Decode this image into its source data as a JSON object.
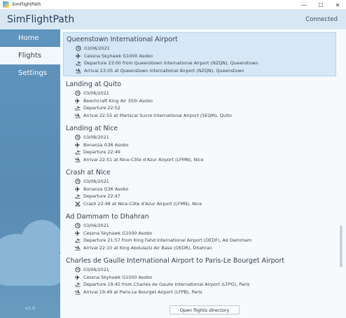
{
  "window": {
    "title": "SimFlightPath",
    "controls": {
      "minimize": "—",
      "maximize": "☐",
      "close": "✕"
    }
  },
  "header": {
    "app_name": "SimFlightPath",
    "status": "Connected"
  },
  "sidebar": {
    "items": [
      {
        "label": "Home",
        "active": false
      },
      {
        "label": "Flights",
        "active": true
      },
      {
        "label": "Settings",
        "active": false
      }
    ],
    "version": "v1.0"
  },
  "flights": [
    {
      "title": "Queenstown International Airport",
      "selected": true,
      "lines": [
        {
          "icon": "clock-icon",
          "text": "03/06/2021"
        },
        {
          "icon": "airplane-icon",
          "text": "Cessna Skyhawk G1000 Asobo"
        },
        {
          "icon": "takeoff-icon",
          "text": "Departure 23:00 from Queenstown International Airport (NZQN), Queenstown"
        },
        {
          "icon": "landing-icon",
          "text": "Arrival 23:05 at Queenstown International Airport (NZQN), Queenstown"
        }
      ]
    },
    {
      "title": "Landing at Quito",
      "selected": false,
      "lines": [
        {
          "icon": "clock-icon",
          "text": "03/06/2021"
        },
        {
          "icon": "airplane-icon",
          "text": "Beechcraft King Air 350i Asobo"
        },
        {
          "icon": "takeoff-icon",
          "text": "Departure 22:52"
        },
        {
          "icon": "landing-icon",
          "text": "Arrival 22:55 at Mariscal Sucre International Airport (SEQM), Quito"
        }
      ]
    },
    {
      "title": "Landing at Nice",
      "selected": false,
      "lines": [
        {
          "icon": "clock-icon",
          "text": "03/06/2021"
        },
        {
          "icon": "airplane-icon",
          "text": "Bonanza G36 Asobo"
        },
        {
          "icon": "takeoff-icon",
          "text": "Departure 22:49"
        },
        {
          "icon": "landing-icon",
          "text": "Arrival 22:51 at Nice-Côte d'Azur Airport (LFMN), Nice"
        }
      ]
    },
    {
      "title": "Crash at Nice",
      "selected": false,
      "lines": [
        {
          "icon": "clock-icon",
          "text": "03/06/2021"
        },
        {
          "icon": "airplane-icon",
          "text": "Bonanza G36 Asobo"
        },
        {
          "icon": "takeoff-icon",
          "text": "Departure 22:47"
        },
        {
          "icon": "crash-icon",
          "text": "Crash 22:48 at Nice-Côte d'Azur Airport (LFMN), Nice"
        }
      ]
    },
    {
      "title": "Ad Dammam to Dhahran",
      "selected": false,
      "lines": [
        {
          "icon": "clock-icon",
          "text": "03/06/2021"
        },
        {
          "icon": "airplane-icon",
          "text": "Cessna Skyhawk G1000 Asobo"
        },
        {
          "icon": "takeoff-icon",
          "text": "Departure 21:57 from King Fahd International Airport (OEDF), Ad Dammam"
        },
        {
          "icon": "landing-icon",
          "text": "Arrival 22:10 at King Abdulaziz Air Base (OEDR), Dhahran"
        }
      ]
    },
    {
      "title": "Charles de Gaulle International Airport to Paris-Le Bourget Airport",
      "selected": false,
      "lines": [
        {
          "icon": "clock-icon",
          "text": "03/06/2021"
        },
        {
          "icon": "airplane-icon",
          "text": "Cessna Skyhawk G1000 Asobo"
        },
        {
          "icon": "takeoff-icon",
          "text": "Departure 19:45 from Charles de Gaulle International Airport (LFPG), Paris"
        },
        {
          "icon": "landing-icon",
          "text": "Arrival 19:49 at Paris-Le Bourget Airport (LFPB), Paris"
        }
      ]
    }
  ],
  "footer": {
    "open_button": "Open flights directory"
  },
  "colors": {
    "sidebar": "#5b8fb7",
    "header": "#d9e7f3",
    "selected_row": "#d6e8f6",
    "text": "#3a434b"
  }
}
